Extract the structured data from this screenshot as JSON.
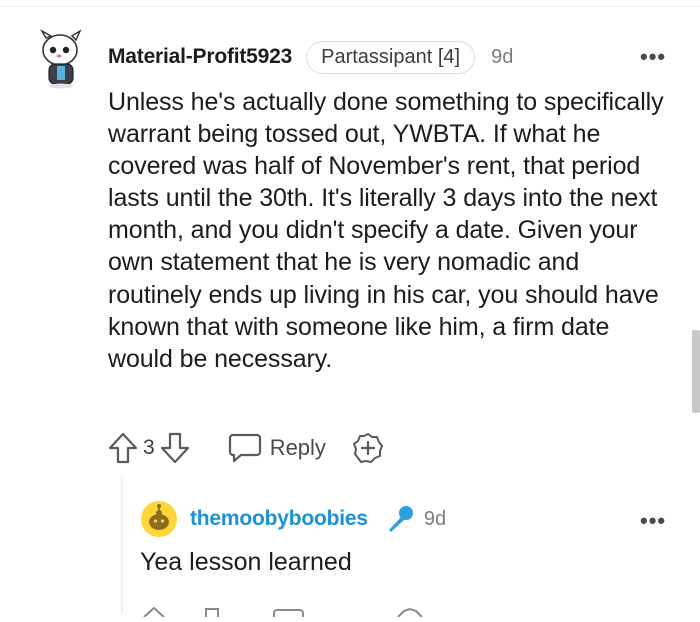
{
  "comment": {
    "username": "Material-Profit5923",
    "flair": "Partassipant [4]",
    "age": "9d",
    "more_label": "•••",
    "body": "Unless he's actually done something to specifically warrant being tossed out, YWBTA. If what he covered was half of November's rent, that period lasts until the 30th. It's literally 3 days into the next month, and you didn't specify a date. Given your own statement that he is very nomadic and routinely ends up living in his car, you should have known that with someone like him, a firm date would be necessary.",
    "votes": "3",
    "reply_label": "Reply",
    "icons": {
      "avatar": "snoo-avatar-icon",
      "upvote": "arrow-up-outline-icon",
      "downvote": "arrow-down-outline-icon",
      "reply": "speech-bubble-icon",
      "award": "award-plus-icon",
      "more": "more-horizontal-icon"
    }
  },
  "reply": {
    "username": "themoobyboobies",
    "age": "9d",
    "more_label": "•••",
    "body": "Yea lesson learned",
    "icons": {
      "avatar": "yellow-snoo-avatar-icon",
      "badge": "microphone-icon",
      "more": "more-horizontal-icon"
    }
  },
  "colors": {
    "username_reply": "#1a92d6",
    "text": "#1c1c1c",
    "meta": "#7c7c7c",
    "avatar_reply_bg": "#ffd635"
  }
}
